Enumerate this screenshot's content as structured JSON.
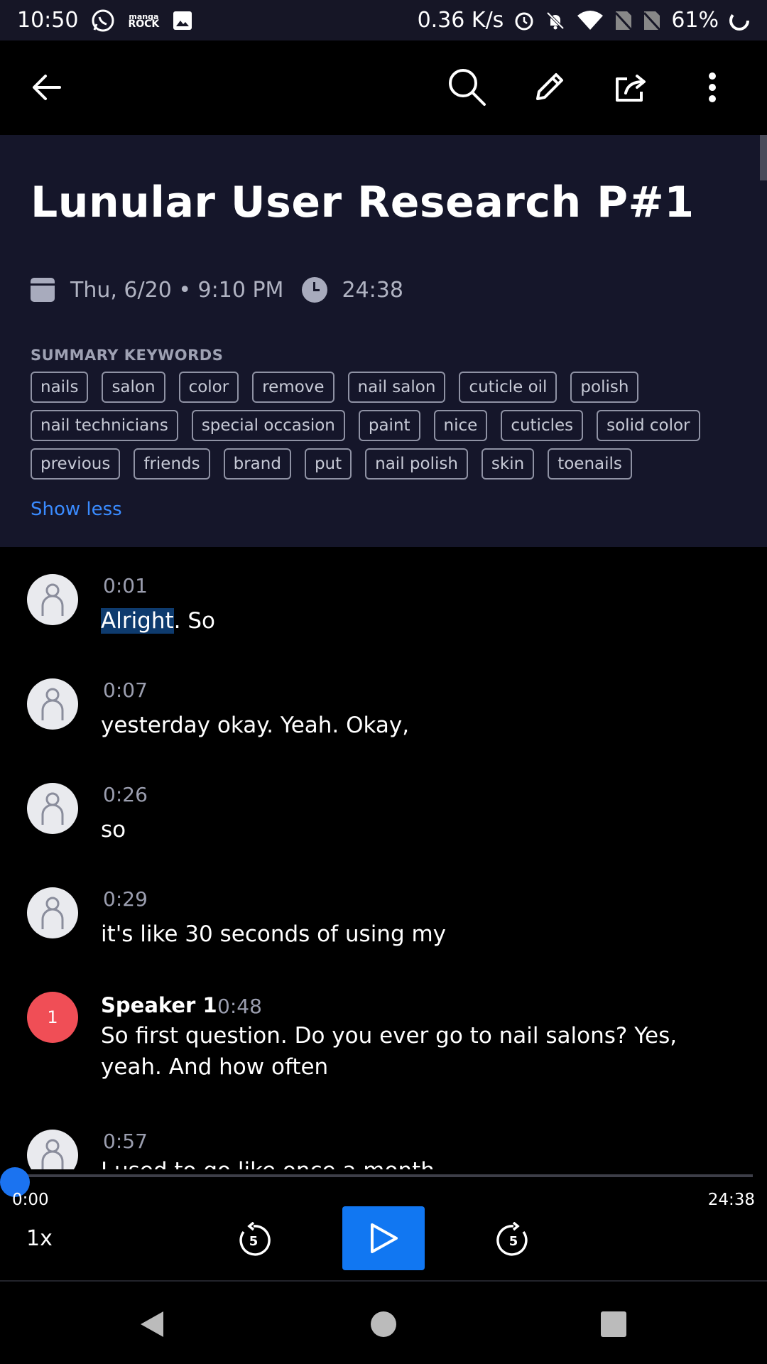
{
  "status_bar": {
    "time": "10:50",
    "manga_text_top": "manga",
    "manga_text_bottom": "ROCK",
    "net_speed": "0.36 K/s",
    "battery": "61%"
  },
  "app_bar": {
    "icons": [
      "back-arrow-icon",
      "search-icon",
      "pencil-icon",
      "share-icon",
      "more-vert-icon"
    ]
  },
  "header": {
    "title": "Lunular User Research P#1",
    "date": "Thu, 6/20 • 9:10 PM",
    "duration": "24:38",
    "keywords_label": "SUMMARY KEYWORDS",
    "keywords": [
      "nails",
      "salon",
      "color",
      "remove",
      "nail salon",
      "cuticle oil",
      "polish",
      "nail technicians",
      "special occasion",
      "paint",
      "nice",
      "cuticles",
      "solid color",
      "previous",
      "friends",
      "brand",
      "put",
      "nail polish",
      "skin",
      "toenails"
    ],
    "show_less": "Show less"
  },
  "transcript": [
    {
      "time": "0:01",
      "highlight": "Alright",
      "text": ". So"
    },
    {
      "time": "0:07",
      "text": "yesterday okay. Yeah. Okay,"
    },
    {
      "time": "0:26",
      "text": "so"
    },
    {
      "time": "0:29",
      "text": "it's like 30 seconds of using my"
    },
    {
      "speaker": "Speaker 1",
      "badge": "1",
      "time": "0:48",
      "text": "So first question. Do you ever go to nail salons? Yes, yeah. And how often"
    },
    {
      "time": "0:57",
      "text": "I used to go like once a month"
    }
  ],
  "player": {
    "current_time": "0:00",
    "total_time": "24:38",
    "speed": "1x",
    "rewind_seconds": "5",
    "forward_seconds": "5",
    "progress": 0,
    "accent": "#1177f2"
  },
  "colors": {
    "header_bg": "#15162a",
    "link": "#3a8bff",
    "speaker_badge": "#f04e56"
  }
}
